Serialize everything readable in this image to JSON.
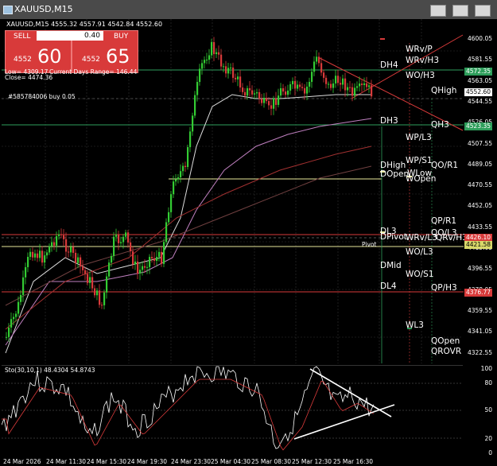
{
  "window": {
    "title": "XAUUSD,M15",
    "minimize_icon": "minimize-icon",
    "maximize_icon": "maximize-icon",
    "close_icon": "close-icon"
  },
  "chart_header": "XAUUSD,M15  4555.32 4557.91 4542.84 4552.60",
  "trade_panel": {
    "sell_label": "SELL",
    "buy_label": "BUY",
    "lot": "0.40",
    "sell_small": "4552",
    "sell_big": "60",
    "buy_small": "4552",
    "buy_big": "65",
    "color": "#d83a3a"
  },
  "info": {
    "low": "Low= 4309.17",
    "range": "Current Days Range= 146.44",
    "close": "Close= 4474.36",
    "order": "#585784006 buy 0.05",
    "pivot_small": "Pivot"
  },
  "price_axis": [
    "4600.05",
    "4581.55",
    "4563.05",
    "4544.55",
    "4526.05",
    "4507.55",
    "4489.05",
    "4470.55",
    "4452.05",
    "4433.55",
    "4415.05",
    "4396.55",
    "4378.05",
    "4359.55",
    "4341.05",
    "4322.55"
  ],
  "price_boxes": [
    {
      "text": "4572.35",
      "color": "#2e9e5b"
    },
    {
      "text": "4552.60",
      "color": "#ffffff"
    },
    {
      "text": "4523.35",
      "color": "#2e9e5b"
    },
    {
      "text": "4426.10",
      "color": "#d83a3a"
    },
    {
      "text": "4421.58",
      "color": "#d8d86a"
    },
    {
      "text": "4376.77",
      "color": "#d83a3a"
    }
  ],
  "levels": {
    "wrv_p": "WRv/P",
    "wrv_h3": "WRv/H3",
    "dh4": "DH4",
    "wo_h3": "WO/H3",
    "qhigh": "QHigh",
    "dh3": "DH3",
    "qh3": "QH3",
    "wp_l3": "WP/L3",
    "wp_s1": "WP/S1",
    "qo_r1": "QO/R1",
    "dhigh": "DHigh",
    "dopen": "DOpen",
    "wlow": "WLow",
    "wopen": "WOpen",
    "qp_r1": "QP/R1",
    "dl3": "DL3",
    "qo_l3": "QO/L3",
    "dpivot": "DPivot",
    "wrv_l": "WRv/L3",
    "qrv_h3": "QRv/H3",
    "wo_l3": "WO/L3",
    "dmid": "DMid",
    "wo_s1": "WO/S1",
    "dl4": "DL4",
    "qp_h3": "QP/H3",
    "wl3": "WL3",
    "qopen": "QOpen",
    "qrovr": "QROVR"
  },
  "stochastic": {
    "label": "Sto(30,10,1) 48.4304 54.8743",
    "axis": [
      "100",
      "80",
      "50",
      "20",
      "0"
    ]
  },
  "time_axis": [
    "24 Mar 2026",
    "24 Mar 11:30",
    "24 Mar 15:30",
    "24 Mar 19:30",
    "24 Mar 23:30",
    "25 Mar 04:30",
    "25 Mar 08:30",
    "25 Mar 12:30",
    "25 Mar 16:30"
  ],
  "colors": {
    "bull": "#33cc33",
    "bear": "#d83a3a",
    "green_level": "#2e9e5b",
    "yellow_level": "#e8e89a",
    "red_level": "#d83a3a"
  }
}
